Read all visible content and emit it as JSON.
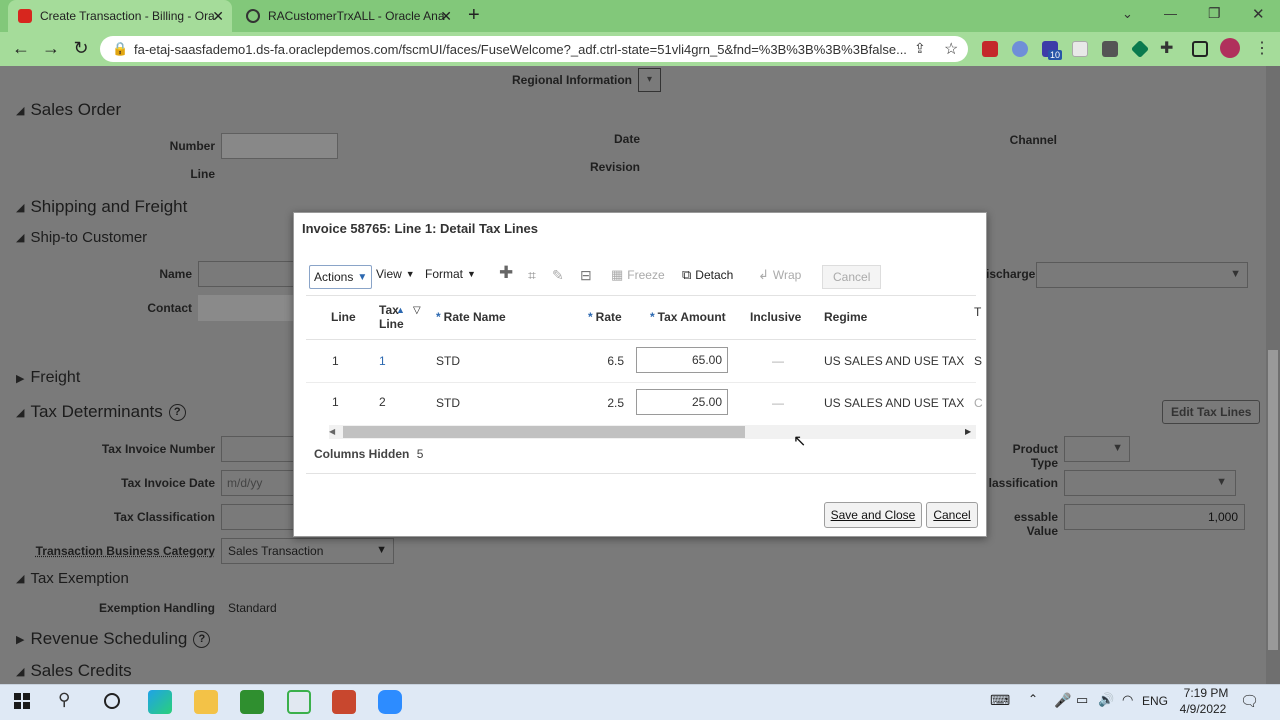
{
  "browser": {
    "tabs": [
      {
        "title": "Create Transaction - Billing - Ora",
        "active": true
      },
      {
        "title": "RACustomerTrxALL - Oracle Ana",
        "active": false
      }
    ],
    "new_tab": "+",
    "url": "fa-etaj-saasfademo1.ds-fa.oraclepdemos.com/fscmUI/faces/FuseWelcome?_adf.ctrl-state=51vli4grn_5&fnd=%3B%3B%3B%3Bfalse...",
    "window_controls": {
      "minimize": "⌄",
      "min": "—",
      "restore": "❐",
      "close": "✕"
    },
    "extension_badge": "10"
  },
  "page": {
    "regional_information": "Regional Information",
    "sales_order": {
      "title": "Sales Order",
      "number": "Number",
      "line": "Line",
      "date": "Date",
      "revision": "Revision",
      "channel": "Channel"
    },
    "shipping_and_freight": "Shipping and Freight",
    "ship_to_customer": {
      "title": "Ship-to Customer",
      "name": "Name",
      "contact": "Contact",
      "discharge": "ischarge"
    },
    "freight": "Freight",
    "tax_determinants": {
      "title": "Tax Determinants",
      "tax_invoice_number": "Tax Invoice Number",
      "tax_invoice_date": "Tax Invoice Date",
      "date_placeholder": "m/d/yy",
      "tax_classification": "Tax Classification",
      "transaction_business_category": "Transaction Business Category",
      "transaction_business_category_value": "Sales Transaction",
      "product_type": "Product Type",
      "classification": "lassification",
      "assessable_value": "essable Value",
      "assessable_value_amount": "1,000",
      "edit_tax_lines": "Edit Tax Lines"
    },
    "tax_exemption": {
      "title": "Tax Exemption",
      "exemption_handling": "Exemption Handling",
      "exemption_value": "Standard"
    },
    "revenue_scheduling": "Revenue Scheduling",
    "sales_credits": "Sales Credits"
  },
  "dialog": {
    "title": "Invoice 58765: Line 1: Detail Tax Lines",
    "toolbar": {
      "actions": "Actions",
      "view": "View",
      "format": "Format",
      "freeze": "Freeze",
      "detach": "Detach",
      "wrap": "Wrap",
      "cancel": "Cancel"
    },
    "columns": {
      "line": "Line",
      "tax": "Tax",
      "tax_line": "Line",
      "rate_name": "Rate Name",
      "rate": "Rate",
      "tax_amount": "Tax Amount",
      "inclusive": "Inclusive",
      "regime": "Regime",
      "cut": "T"
    },
    "rows": [
      {
        "line": "1",
        "tax_line": "1",
        "rate_name": "STD",
        "rate": "6.5",
        "tax_amount": "65.00",
        "inclusive": "—",
        "regime": "US SALES AND USE TAX",
        "cut": "S"
      },
      {
        "line": "1",
        "tax_line": "2",
        "rate_name": "STD",
        "rate": "2.5",
        "tax_amount": "25.00",
        "inclusive": "—",
        "regime": "US SALES AND USE TAX",
        "cut": "C"
      }
    ],
    "columns_hidden_label": "Columns Hidden",
    "columns_hidden_count": "5",
    "save_and_close": "Save and Close",
    "cancel": "Cancel"
  },
  "taskbar": {
    "lang": "ENG",
    "time": "7:19 PM",
    "date": "4/9/2022"
  }
}
